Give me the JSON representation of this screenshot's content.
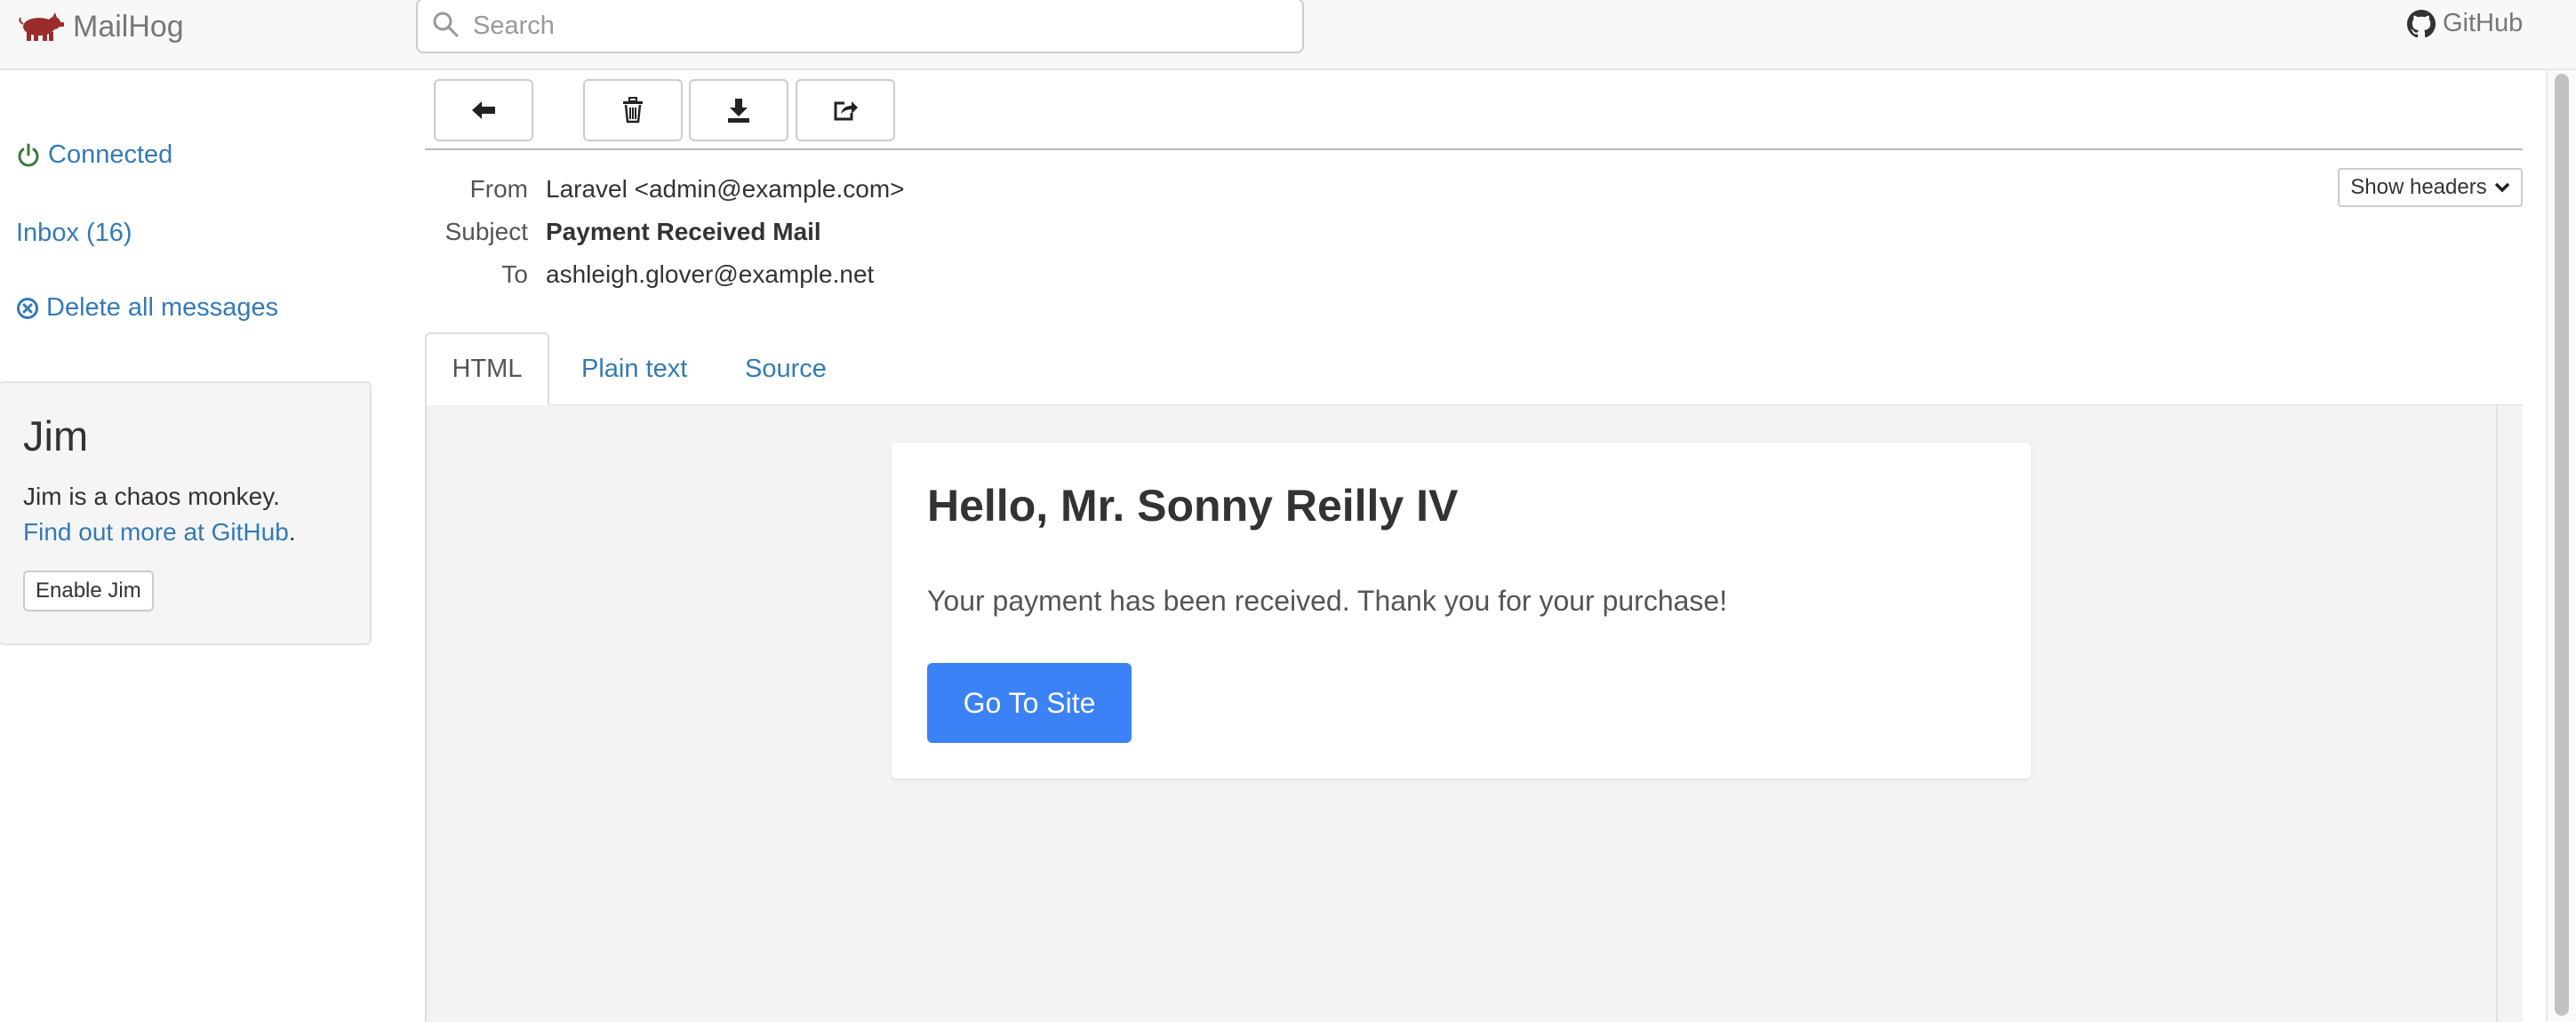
{
  "navbar": {
    "brand": "MailHog",
    "search_placeholder": "Search",
    "github_label": "GitHub"
  },
  "sidebar": {
    "connected": "Connected",
    "inbox": "Inbox (16)",
    "delete_all": "Delete all messages",
    "jim": {
      "title": "Jim",
      "description": "Jim is a chaos monkey.",
      "link": "Find out more at GitHub",
      "period": ".",
      "enable_button": "Enable Jim"
    }
  },
  "toolbar": {
    "back_icon": "arrow-left-icon",
    "delete_icon": "trash-icon",
    "download_icon": "download-icon",
    "release_icon": "share-icon"
  },
  "message": {
    "from_label": "From",
    "from": "Laravel <admin@example.com>",
    "subject_label": "Subject",
    "subject": "Payment Received Mail",
    "to_label": "To",
    "to": "ashleigh.glover@example.net",
    "show_headers": "Show headers"
  },
  "tabs": [
    {
      "label": "HTML",
      "active": true
    },
    {
      "label": "Plain text",
      "active": false
    },
    {
      "label": "Source",
      "active": false
    }
  ],
  "email": {
    "greeting": "Hello, Mr. Sonny Reilly IV",
    "body": "Your payment has been received. Thank you for your purchase!",
    "button": "Go To Site",
    "button_color": "#3b82f6"
  },
  "colors": {
    "link": "#337ab7",
    "connected": "#3c763d",
    "brand_icon": "#9b2c2c"
  }
}
